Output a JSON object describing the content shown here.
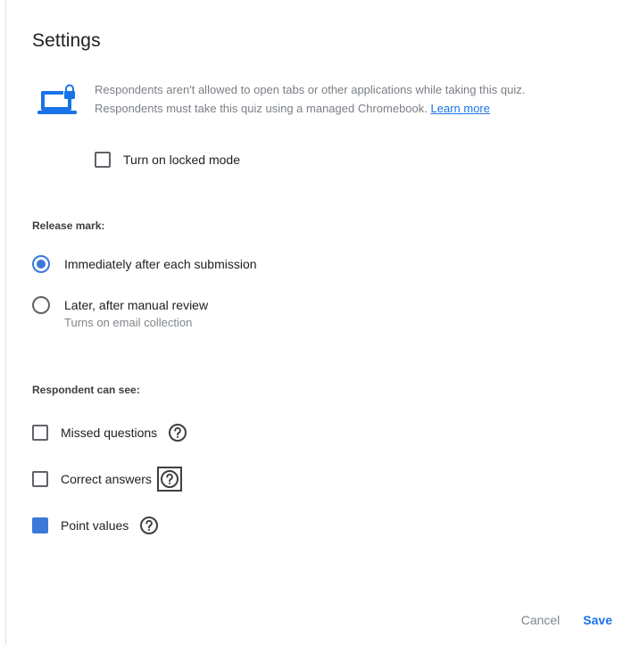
{
  "dialog": {
    "title": "Settings"
  },
  "locked_mode": {
    "description": "Respondents aren't allowed to open tabs or other applications while taking this quiz. Respondents must take this quiz using a managed Chromebook.",
    "learn_more": "Learn more",
    "checkbox_label": "Turn on locked mode",
    "checked": false,
    "icon": "chromebook-lock-icon"
  },
  "release_mark": {
    "heading": "Release mark:",
    "options": [
      {
        "label": "Immediately after each submission",
        "sublabel": "",
        "selected": true
      },
      {
        "label": "Later, after manual review",
        "sublabel": "Turns on email collection",
        "selected": false
      }
    ]
  },
  "respondent_can_see": {
    "heading": "Respondent can see:",
    "items": [
      {
        "label": "Missed questions",
        "checked": false,
        "icon": "help-icon"
      },
      {
        "label": "Correct answers",
        "checked": false,
        "icon": "help-icon",
        "focused": true
      },
      {
        "label": "Point values",
        "checked": true,
        "icon": "help-icon"
      }
    ]
  },
  "footer": {
    "cancel": "Cancel",
    "save": "Save"
  },
  "colors": {
    "accent": "#3c78d8",
    "link": "#1a73e8",
    "muted": "#80868b"
  }
}
